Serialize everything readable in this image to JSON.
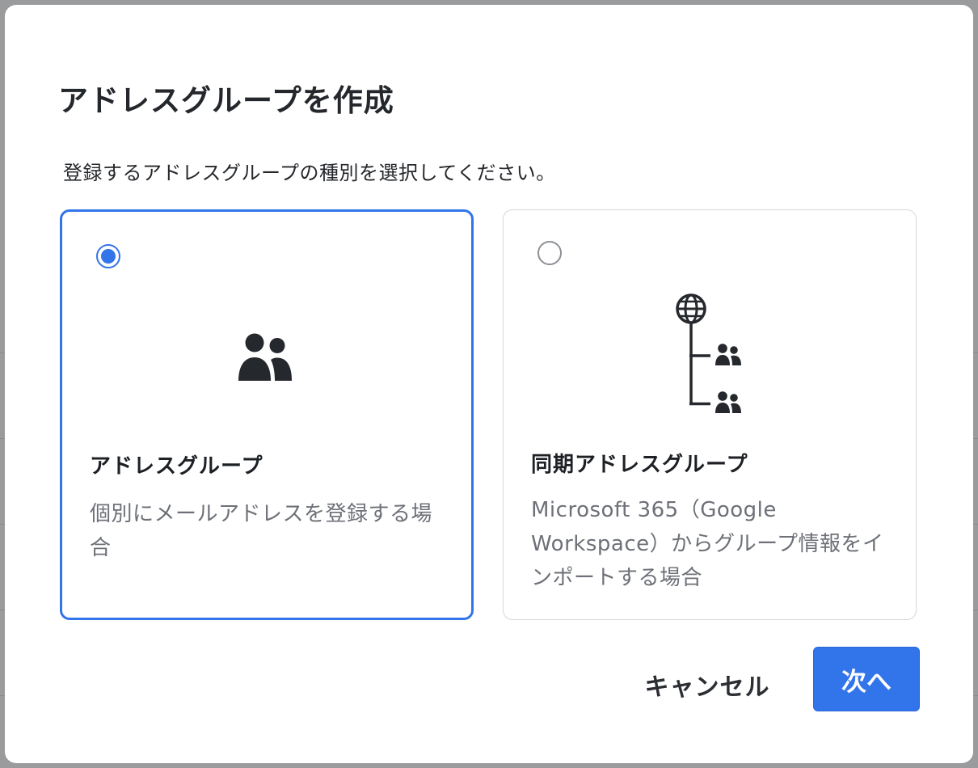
{
  "dialog": {
    "title": "アドレスグループを作成",
    "instruction": "登録するアドレスグループの種別を選択してください。"
  },
  "options": [
    {
      "title": "アドレスグループ",
      "description": "個別にメールアドレスを登録する場合",
      "selected": true,
      "icon": "people-icon"
    },
    {
      "title": "同期アドレスグループ",
      "description": "Microsoft 365（Google Workspace）からグループ情報をインポートする場合",
      "selected": false,
      "icon": "globe-tree-people-icon"
    }
  ],
  "actions": {
    "cancel_label": "キャンセル",
    "next_label": "次へ"
  },
  "colors": {
    "accent": "#3274ea",
    "overlay": "#8c8d8f",
    "text_primary": "#24272b",
    "text_secondary": "#6d7077",
    "icon": "#25282c"
  }
}
